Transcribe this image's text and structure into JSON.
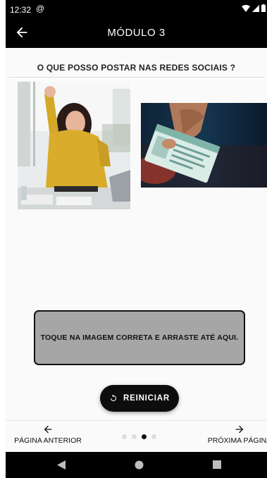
{
  "status": {
    "time": "12:32"
  },
  "appbar": {
    "title": "MÓDULO 3"
  },
  "question": "O QUE POSSO POSTAR NAS REDES SOCIAIS ?",
  "dropzone": {
    "text": "TOQUE NA IMAGEM CORRETA E ARRASTE ATÉ AQUI."
  },
  "restart": {
    "label": "REINICIAR"
  },
  "nav": {
    "prev_label": "PÁGINA ANTERIOR",
    "next_label": "PRÓXIMA PÁGINA",
    "pages_total": 4,
    "page_current": 3
  },
  "icons": [
    "wifi-icon",
    "signal-icon",
    "battery-icon",
    "back-arrow-icon",
    "restart-icon",
    "arrow-left-icon",
    "arrow-right-icon"
  ]
}
